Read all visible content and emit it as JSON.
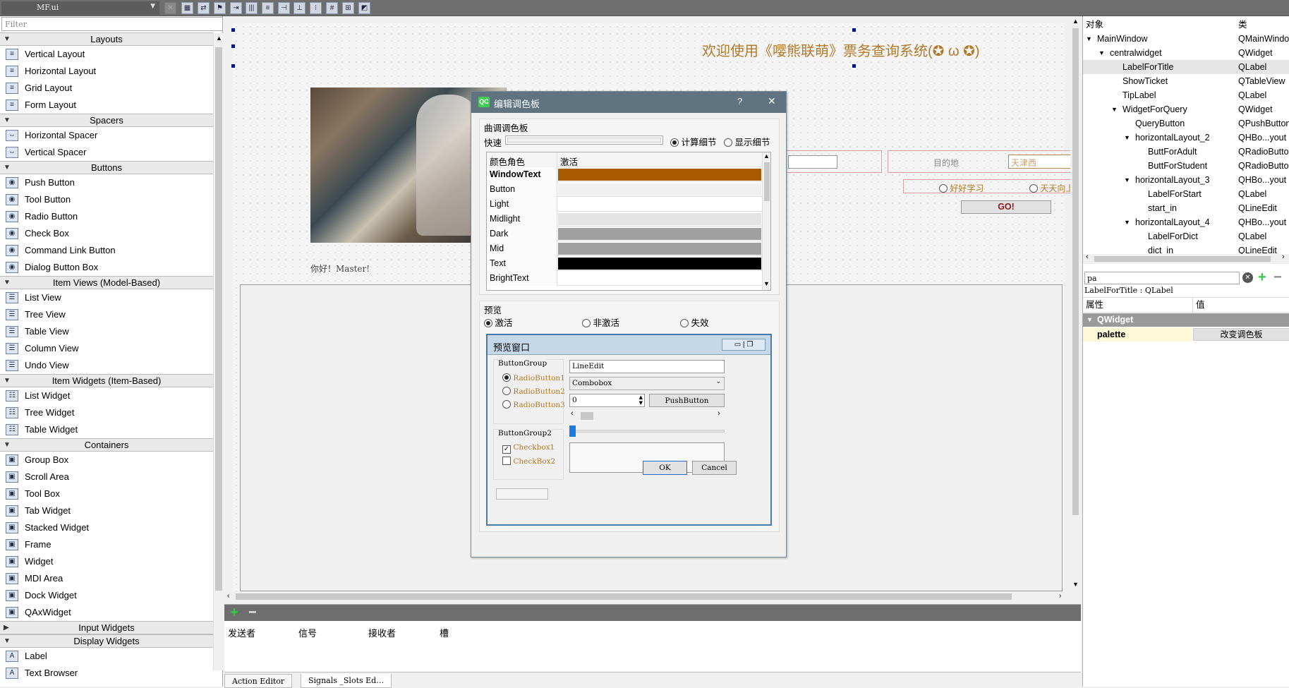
{
  "toolbar": {
    "file_combo": "MF.ui"
  },
  "widgetbox": {
    "filter_placeholder": "Filter",
    "categories": [
      {
        "label": "Layouts",
        "items": [
          "Vertical Layout",
          "Horizontal Layout",
          "Grid Layout",
          "Form Layout"
        ]
      },
      {
        "label": "Spacers",
        "items": [
          "Horizontal Spacer",
          "Vertical Spacer"
        ]
      },
      {
        "label": "Buttons",
        "items": [
          "Push Button",
          "Tool Button",
          "Radio Button",
          "Check Box",
          "Command Link Button",
          "Dialog Button Box"
        ]
      },
      {
        "label": "Item Views (Model-Based)",
        "items": [
          "List View",
          "Tree View",
          "Table View",
          "Column View",
          "Undo View"
        ]
      },
      {
        "label": "Item Widgets (Item-Based)",
        "items": [
          "List Widget",
          "Tree Widget",
          "Table Widget"
        ]
      },
      {
        "label": "Containers",
        "items": [
          "Group Box",
          "Scroll Area",
          "Tool Box",
          "Tab Widget",
          "Stacked Widget",
          "Frame",
          "Widget",
          "MDI Area",
          "Dock Widget",
          "QAxWidget"
        ]
      },
      {
        "label": "Input Widgets",
        "items": []
      },
      {
        "label": "Display Widgets",
        "items": [
          "Label",
          "Text Browser"
        ]
      }
    ]
  },
  "form": {
    "title": "欢迎使用《嘤熊联萌》票务查询系统(✪ ω ✪)",
    "hello": "你好！Master!",
    "dest_label": "目的地",
    "dest_value": "天津西",
    "radio1": "好好学习",
    "radio2": "天天向上",
    "go": "GO!"
  },
  "signals": {
    "headers": [
      "发送者",
      "信号",
      "接收者",
      "槽"
    ],
    "tabs": [
      "Action Editor",
      "Signals _Slots Ed…"
    ]
  },
  "inspector": {
    "col_object": "对象",
    "col_class": "类",
    "rows": [
      {
        "name": "MainWindow",
        "cls": "QMainWindow"
      },
      {
        "name": "centralwidget",
        "cls": "QWidget"
      },
      {
        "name": "LabelForTitle",
        "cls": "QLabel"
      },
      {
        "name": "ShowTicket",
        "cls": "QTableView"
      },
      {
        "name": "TipLabel",
        "cls": "QLabel"
      },
      {
        "name": "WidgetForQuery",
        "cls": "QWidget"
      },
      {
        "name": "QueryButton",
        "cls": "QPushButton"
      },
      {
        "name": "horizontalLayout_2",
        "cls": "QHBo...yout"
      },
      {
        "name": "ButtForAdult",
        "cls": "QRadioButton"
      },
      {
        "name": "ButtForStudent",
        "cls": "QRadioButton"
      },
      {
        "name": "horizontalLayout_3",
        "cls": "QHBo...yout"
      },
      {
        "name": "LabelForStart",
        "cls": "QLabel"
      },
      {
        "name": "start_in",
        "cls": "QLineEdit"
      },
      {
        "name": "horizontalLayout_4",
        "cls": "QHBo...yout"
      },
      {
        "name": "LabelForDict",
        "cls": "QLabel"
      },
      {
        "name": "dict_in",
        "cls": "QLineEdit"
      }
    ]
  },
  "propedit": {
    "filter_value": "pa",
    "object_label": "LabelForTitle : QLabel",
    "col_prop": "属性",
    "col_value": "值",
    "group": "QWidget",
    "prop_name": "palette",
    "prop_value": "改变调色板"
  },
  "dialog": {
    "title": "编辑调色板",
    "help": "?",
    "close": "✕",
    "tune_group": "曲调调色板",
    "quick": "快速",
    "calc_detail": "计算细节",
    "show_detail": "显示细节",
    "col_role": "颜色角色",
    "col_active": "激活",
    "roles": [
      {
        "name": "WindowText",
        "color": "#a85a00",
        "bold": true
      },
      {
        "name": "Button",
        "color": "#f0f0f0"
      },
      {
        "name": "Light",
        "color": "#ffffff"
      },
      {
        "name": "Midlight",
        "color": "#e3e3e3"
      },
      {
        "name": "Dark",
        "color": "#a0a0a0"
      },
      {
        "name": "Mid",
        "color": "#a0a0a0"
      },
      {
        "name": "Text",
        "color": "#000000"
      },
      {
        "name": "BrightText",
        "color": "#ffffff"
      }
    ],
    "preview_group": "预览",
    "pv_active": "激活",
    "pv_inactive": "非激活",
    "pv_disabled": "失效",
    "pv_window": "预览窗口",
    "buttongroup": "ButtonGroup",
    "radios": [
      "RadioButton1",
      "RadioButton2",
      "RadioButton3"
    ],
    "buttongroup2": "ButtonGroup2",
    "checks": [
      "Checkbox1",
      "CheckBox2"
    ],
    "lineedit": "LineEdit",
    "combobox": "Combobox",
    "spin": "0",
    "pushbutton": "PushButton",
    "ok": "OK",
    "cancel": "Cancel"
  }
}
